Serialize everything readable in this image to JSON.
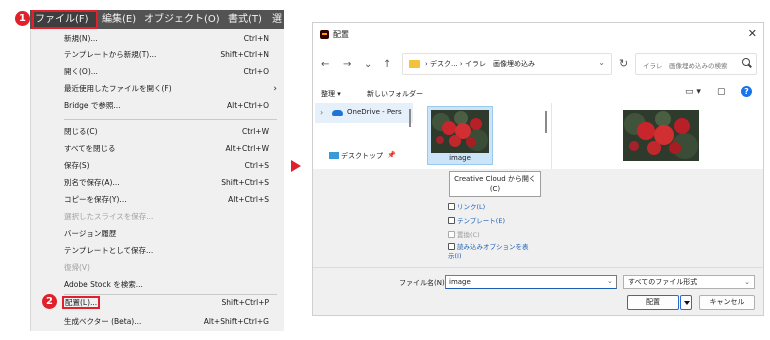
{
  "steps": {
    "step1": "1",
    "step2": "2"
  },
  "menubar": {
    "items": [
      "ファイル(F)",
      "編集(E)",
      "オブジェクト(O)",
      "書式(T)",
      "選"
    ]
  },
  "menu": {
    "items": [
      {
        "label": "新規(N)...",
        "shortcut": "Ctrl+N"
      },
      {
        "label": "テンプレートから新規(T)...",
        "shortcut": "Shift+Ctrl+N"
      },
      {
        "label": "開く(O)...",
        "shortcut": "Ctrl+O"
      },
      {
        "label": "最近使用したファイルを開く(F)",
        "shortcut": "›"
      },
      {
        "label": "Bridge で参照...",
        "shortcut": "Alt+Ctrl+O"
      },
      {
        "label": "閉じる(C)",
        "shortcut": "Ctrl+W"
      },
      {
        "label": "すべてを閉じる",
        "shortcut": "Alt+Ctrl+W"
      },
      {
        "label": "保存(S)",
        "shortcut": "Ctrl+S"
      },
      {
        "label": "別名で保存(A)...",
        "shortcut": "Shift+Ctrl+S"
      },
      {
        "label": "コピーを保存(Y)...",
        "shortcut": "Alt+Ctrl+S"
      },
      {
        "label": "選択したスライスを保存...",
        "shortcut": ""
      },
      {
        "label": "バージョン履歴",
        "shortcut": ""
      },
      {
        "label": "テンプレートとして保存...",
        "shortcut": ""
      },
      {
        "label": "復帰(V)",
        "shortcut": ""
      },
      {
        "label": "Adobe Stock を検索...",
        "shortcut": ""
      },
      {
        "label": "配置(L)...",
        "shortcut": "Shift+Ctrl+P"
      },
      {
        "label": "生成ベクター (Beta)...",
        "shortcut": "Alt+Shift+Ctrl+G"
      }
    ]
  },
  "dialog": {
    "title": "配置",
    "close": "✕",
    "nav": {
      "back": "←",
      "forward": "→",
      "down": "⌄",
      "up": "↑",
      "refresh": "↻"
    },
    "address": "› デスク... › イラレ　画像埋め込み",
    "address_chevron": "⌄",
    "search_placeholder": "イラレ　画像埋め込みの検索",
    "toolbar": {
      "organize": "整理 ▾",
      "new_folder": "新しいフォルダー",
      "view": "▭ ▾",
      "pane": "▢",
      "help": "?"
    },
    "nav_pane": {
      "onedrive": "OneDrive - Pers",
      "desktop": "デスクトップ",
      "pin": "📌"
    },
    "file": {
      "name": "image"
    },
    "tooltip": "Creative Cloud から開く\n(C)",
    "options": [
      {
        "label": "リンク(L)",
        "disabled": false
      },
      {
        "label": "テンプレート(E)",
        "disabled": false
      },
      {
        "label": "置換(C)",
        "disabled": true
      },
      {
        "label": "読み込みオプションを表\n示(I)",
        "disabled": false
      }
    ],
    "filename_label": "ファイル名(N):",
    "filename_value": "image",
    "filetype_value": "すべてのファイル形式",
    "place_button": "配置",
    "cancel_button": "キャンセル"
  }
}
